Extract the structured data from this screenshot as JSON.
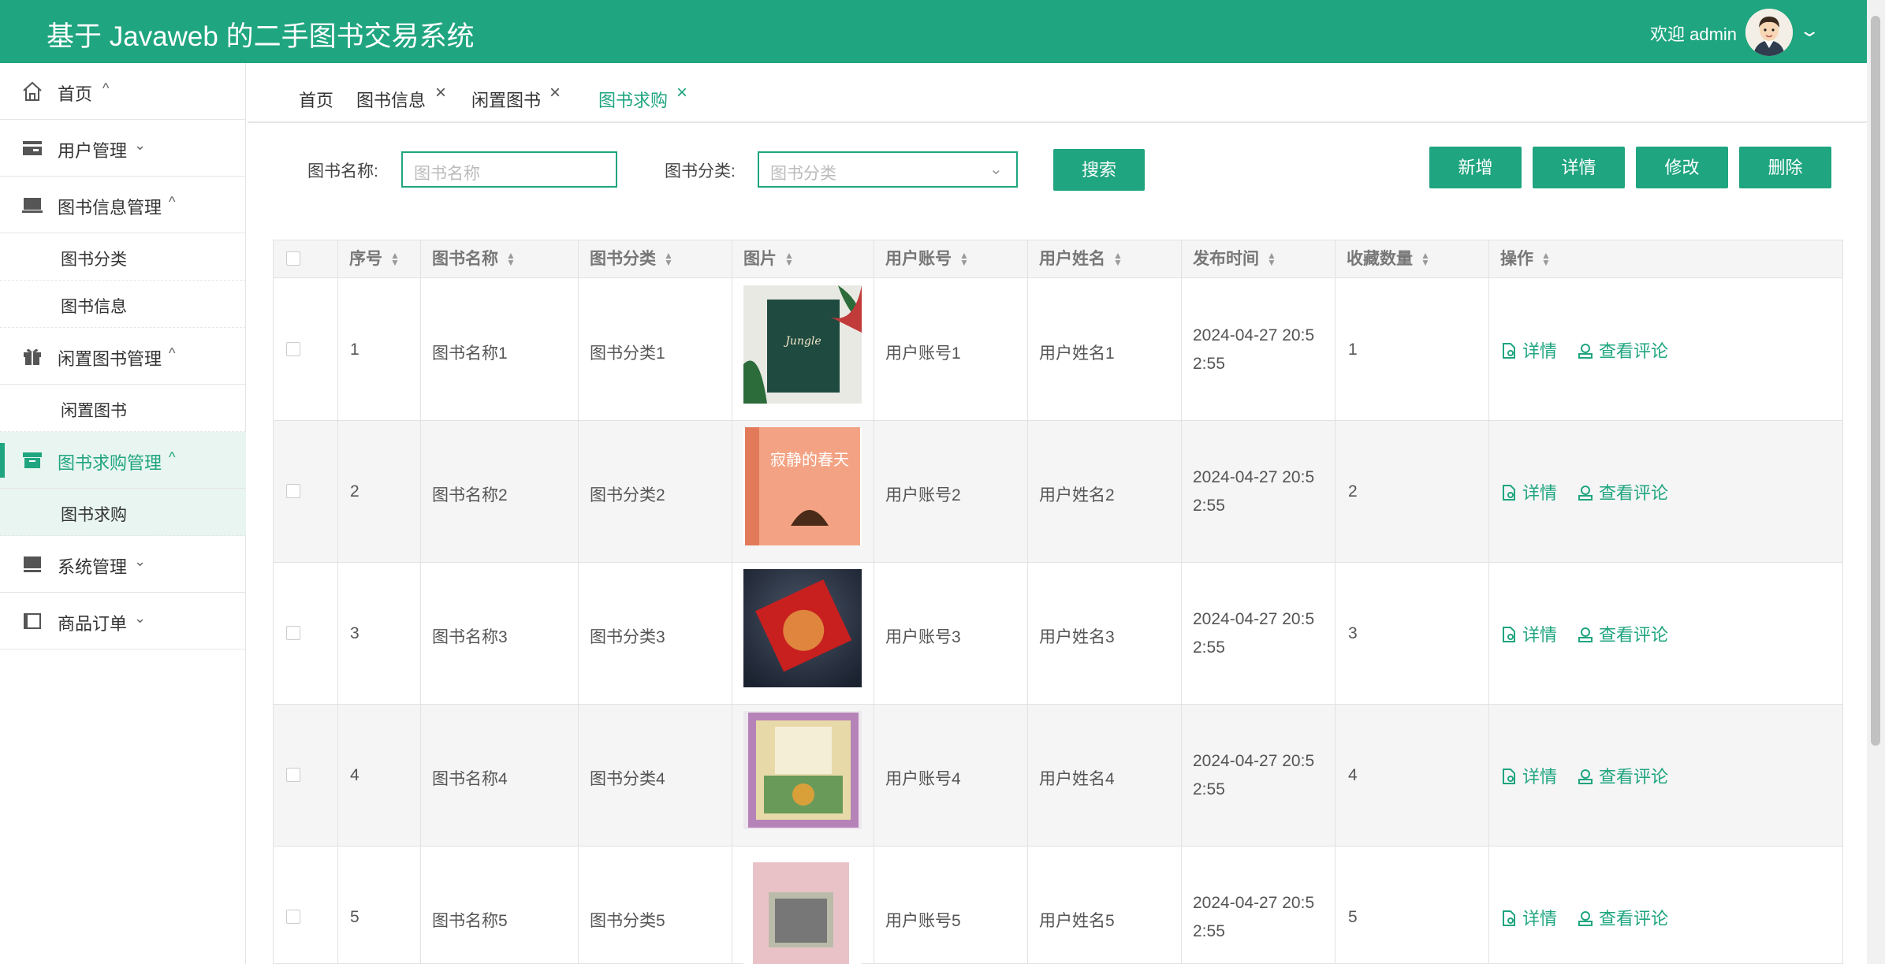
{
  "header": {
    "title": "基于 Javaweb 的二手图书交易系统",
    "welcome": "欢迎 admin",
    "accent": "#1fa57f"
  },
  "sidebar": {
    "menus": [
      {
        "label": "首页",
        "icon": "home-icon",
        "arrow": "^"
      },
      {
        "label": "用户管理",
        "icon": "user-card-icon",
        "arrow": "v"
      },
      {
        "label": "图书信息管理",
        "icon": "laptop-icon",
        "arrow": "^"
      },
      {
        "label": "闲置图书管理",
        "icon": "gift-icon",
        "arrow": "^"
      },
      {
        "label": "图书求购管理",
        "icon": "box-icon",
        "arrow": "^"
      },
      {
        "label": "系统管理",
        "icon": "monitor-icon",
        "arrow": "v"
      },
      {
        "label": "商品订单",
        "icon": "book-icon",
        "arrow": "v"
      }
    ],
    "subs": {
      "book_category": "图书分类",
      "book_info": "图书信息",
      "idle_book": "闲置图书",
      "book_purchase": "图书求购"
    }
  },
  "tabs": [
    {
      "label": "首页"
    },
    {
      "label": "图书信息"
    },
    {
      "label": "闲置图书"
    },
    {
      "label": "图书求购"
    }
  ],
  "search": {
    "name_label": "图书名称:",
    "name_placeholder": "图书名称",
    "category_label": "图书分类:",
    "category_placeholder": "图书分类",
    "search_button": "搜索"
  },
  "toolbar": {
    "add": "新增",
    "detail": "详情",
    "edit": "修改",
    "delete": "删除"
  },
  "table": {
    "columns": [
      "序号",
      "图书名称",
      "图书分类",
      "图片",
      "用户账号",
      "用户姓名",
      "发布时间",
      "收藏数量",
      "操作"
    ],
    "actions": {
      "detail": "详情",
      "comments": "查看评论"
    },
    "rows": [
      {
        "no": "1",
        "name": "图书名称1",
        "category": "图书分类1",
        "account": "用户账号1",
        "username": "用户姓名1",
        "time_a": "2024-04-27 20:5",
        "time_b": "2:55",
        "favorites": "1"
      },
      {
        "no": "2",
        "name": "图书名称2",
        "category": "图书分类2",
        "account": "用户账号2",
        "username": "用户姓名2",
        "time_a": "2024-04-27 20:5",
        "time_b": "2:55",
        "favorites": "2"
      },
      {
        "no": "3",
        "name": "图书名称3",
        "category": "图书分类3",
        "account": "用户账号3",
        "username": "用户姓名3",
        "time_a": "2024-04-27 20:5",
        "time_b": "2:55",
        "favorites": "3"
      },
      {
        "no": "4",
        "name": "图书名称4",
        "category": "图书分类4",
        "account": "用户账号4",
        "username": "用户姓名4",
        "time_a": "2024-04-27 20:5",
        "time_b": "2:55",
        "favorites": "4"
      },
      {
        "no": "5",
        "name": "图书名称5",
        "category": "图书分类5",
        "account": "用户账号5",
        "username": "用户姓名5",
        "time_a": "2024-04-27 20:5",
        "time_b": "2:55",
        "favorites": "5"
      }
    ],
    "cover_texts": {
      "cover2": "寂静的春天"
    }
  }
}
